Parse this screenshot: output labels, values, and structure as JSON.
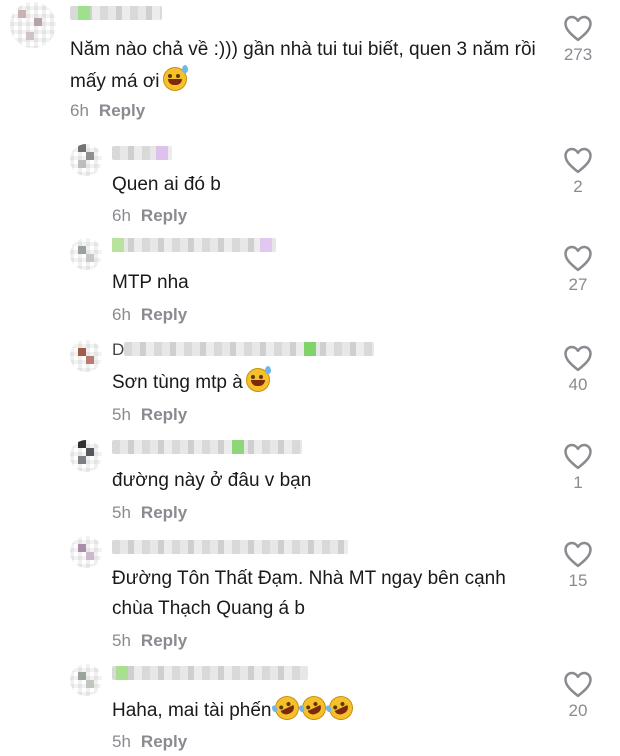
{
  "comments": [
    {
      "text": "Năm nào chả về :))) gần nhà tui tui biết, quen 3 năm rồi mấy má ơi",
      "emoji": "grinning-sweat-emoji",
      "time": "6h",
      "reply_label": "Reply",
      "likes": "273"
    },
    {
      "text": "Quen ai đó b",
      "time": "6h",
      "reply_label": "Reply",
      "likes": "2"
    },
    {
      "text": "MTP nha",
      "time": "6h",
      "reply_label": "Reply",
      "likes": "27"
    },
    {
      "username_initial": "D",
      "text": "Sơn tùng mtp à",
      "emoji": "grinning-sweat-emoji",
      "time": "5h",
      "reply_label": "Reply",
      "likes": "40"
    },
    {
      "text": "đường này ở đâu v bạn",
      "time": "5h",
      "reply_label": "Reply",
      "likes": "1"
    },
    {
      "text": "Đường Tôn Thất Đạm. Nhà MT ngay bên cạnh chùa Thạch Quang á b",
      "time": "5h",
      "reply_label": "Reply",
      "likes": "15"
    },
    {
      "text": "Haha, mai tài phến",
      "emoji": "rolling-laughing-emoji",
      "time": "5h",
      "reply_label": "Reply",
      "likes": "20"
    }
  ],
  "colors": {
    "text": "#1a1a1a",
    "meta": "#8a8b91",
    "heart_outline": "#8a8b91"
  },
  "icons": {
    "like": "heart-outline-icon"
  }
}
